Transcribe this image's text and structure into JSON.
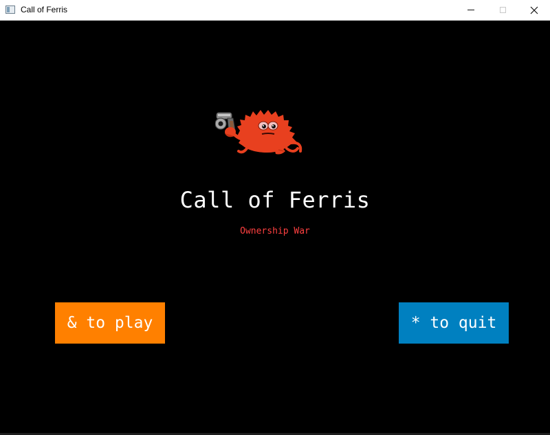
{
  "window": {
    "title": "Call of Ferris",
    "controls": [
      "minimize",
      "maximize",
      "close"
    ]
  },
  "game": {
    "title": "Call of Ferris",
    "subtitle": "Ownership War",
    "mascot": "ferris-crab-with-pistol",
    "buttons": {
      "play_label": "& to play",
      "quit_label": "* to quit"
    }
  },
  "colors": {
    "background": "#000000",
    "title": "#ffffff",
    "subtitle": "#ff4040",
    "play_button": "#ff8000",
    "quit_button": "#0080c0",
    "crab": "#e8401f"
  }
}
